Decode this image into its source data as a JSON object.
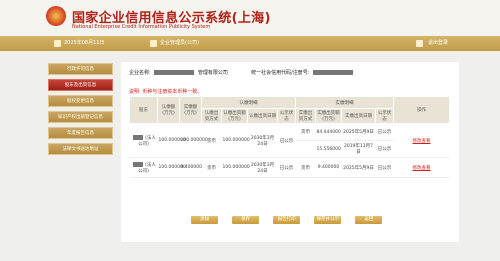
{
  "header": {
    "title_cn": "国家企业信用信息公示系统(上海)",
    "title_en": "National Enterprise Credit Information Publicity System"
  },
  "topbar": {
    "date": "2025年08月11日",
    "user": "企业管理员(公司)",
    "logout": "退出登录"
  },
  "sidebar": {
    "items": [
      {
        "label": "年度报告信息"
      },
      {
        "label": "股东及出资信息"
      },
      {
        "label": "股权变更信息"
      },
      {
        "label": "知识产权出质登记信息"
      },
      {
        "label": "行政许可信息"
      },
      {
        "label": "法律文书送达地址"
      }
    ]
  },
  "company": {
    "name_label": "企业名称:",
    "name_suffix": "管理有限公司",
    "code_label": "统一社会信用代码/注册号:"
  },
  "note": "说明: 币种与注册资本币种一致。",
  "table": {
    "headers": {
      "shareholder": "股东",
      "subscribed_amount": "认缴额\n(万元)",
      "paid_amount": "实缴额\n(万元)",
      "subscribed_detail": "认缴明细",
      "paid_detail": "实缴明细",
      "method": "认缴出资方式",
      "amount": "认缴出资额\n(万元)",
      "date": "认缴出资日期",
      "status": "公示状态",
      "paid_method": "实缴出资方式",
      "paid_amount2": "实缴出资额\n(万元)",
      "paid_date": "实缴出资日期",
      "paid_status": "公示状态",
      "action": "操作"
    },
    "rows": [
      {
        "shareholder": "(法人公司)",
        "subscribed": "100.000000",
        "paid": "100.000000",
        "sub_method": "货币",
        "sub_amount": "100.000000",
        "sub_date": "2030年3月24日",
        "sub_status": "已公示",
        "paid_lines": [
          {
            "method": "货币",
            "amount": "84.444000",
            "date": "2025年5月9日",
            "status": "已公示"
          },
          {
            "method": "",
            "amount": "15.556000",
            "date": "2019年11月7日",
            "status": "已公示"
          }
        ],
        "action": "修改查看"
      },
      {
        "shareholder": "(法人公司)",
        "subscribed": "100.000000",
        "paid": "9.400000",
        "sub_method": "货币",
        "sub_amount": "100.000000",
        "sub_date": "2030年3月24日",
        "sub_status": "已公示",
        "paid_lines": [
          {
            "method": "货币",
            "amount": "9.400000",
            "date": "2025年5月9日",
            "status": "已公示"
          }
        ],
        "action": "修改查看"
      }
    ]
  },
  "buttons": {
    "add": "添加",
    "save": "保存",
    "print": "报告打印",
    "save_publish": "保存并公示",
    "back": "返回"
  },
  "colors": {
    "brand_red": "#b1231a",
    "gold": "#c29c48",
    "active_red": "#9e2015"
  }
}
